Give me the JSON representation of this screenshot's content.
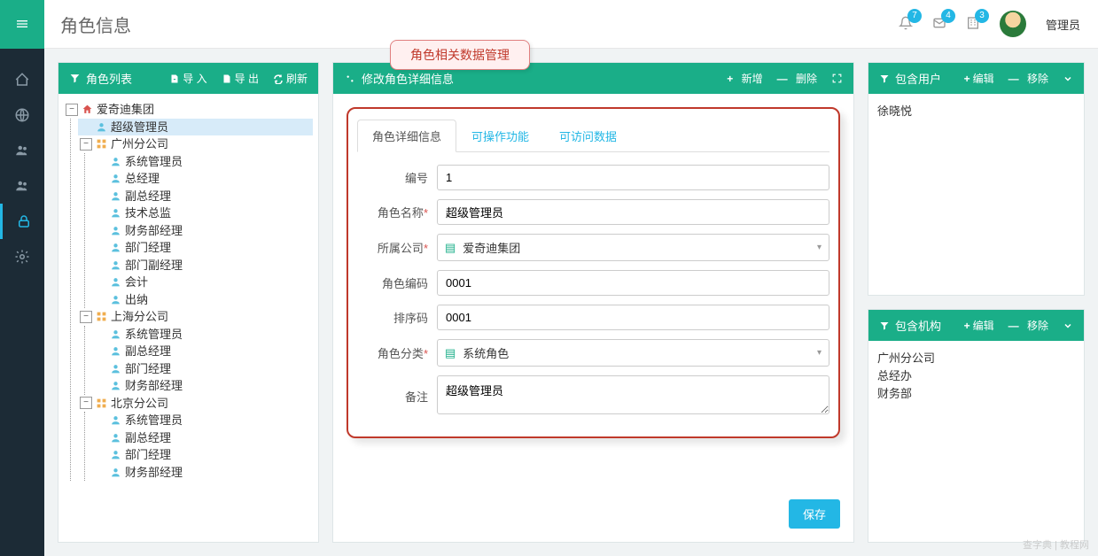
{
  "header": {
    "title": "角色信息",
    "admin_label": "管理员",
    "badges": {
      "bell": "7",
      "mail": "4",
      "org": "3"
    }
  },
  "callout": "角色相关数据管理",
  "left": {
    "title": "角色列表",
    "import": "导 入",
    "export": "导 出",
    "refresh": "刷新"
  },
  "tree": {
    "root": "爱奇迪集团",
    "root_children": [
      {
        "label": "超级管理员",
        "selected": true
      },
      {
        "label": "广州分公司",
        "type": "org",
        "children": [
          "系统管理员",
          "总经理",
          "副总经理",
          "技术总监",
          "财务部经理",
          "部门经理",
          "部门副经理",
          "会计",
          "出纳"
        ]
      },
      {
        "label": "上海分公司",
        "type": "org",
        "children": [
          "系统管理员",
          "副总经理",
          "部门经理",
          "财务部经理"
        ]
      },
      {
        "label": "北京分公司",
        "type": "org",
        "children": [
          "系统管理员",
          "副总经理",
          "部门经理",
          "财务部经理"
        ]
      }
    ]
  },
  "center": {
    "title": "修改角色详细信息",
    "add": "新增",
    "delete": "删除",
    "tabs": [
      "角色详细信息",
      "可操作功能",
      "可访问数据"
    ],
    "labels": {
      "id": "编号",
      "name": "角色名称",
      "company": "所属公司",
      "code": "角色编码",
      "sort": "排序码",
      "category": "角色分类",
      "remark": "备注"
    },
    "values": {
      "id": "1",
      "name": "超级管理员",
      "company": "爱奇迪集团",
      "code": "0001",
      "sort": "0001",
      "category": "系统角色",
      "remark": "超级管理员"
    },
    "save": "保存"
  },
  "right_users": {
    "title": "包含用户",
    "edit": "编辑",
    "remove": "移除",
    "items": [
      "徐晓悦"
    ]
  },
  "right_orgs": {
    "title": "包含机构",
    "edit": "编辑",
    "remove": "移除",
    "items": [
      "广州分公司",
      "总经办",
      "财务部"
    ]
  },
  "watermark": "查字典 | 教程网"
}
